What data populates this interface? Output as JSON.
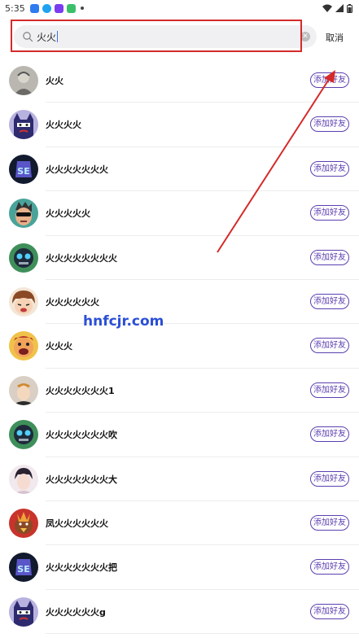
{
  "status_bar": {
    "time": "5:35",
    "app_icons": [
      {
        "name": "app-icon-1",
        "color": "#2f7bf0"
      },
      {
        "name": "app-icon-2",
        "color": "#1fa3f0"
      },
      {
        "name": "app-icon-3",
        "color": "#7a3df0"
      },
      {
        "name": "app-icon-4",
        "color": "#3bbf6a"
      }
    ],
    "icons": [
      "wifi-icon",
      "signal-icon",
      "battery-icon"
    ]
  },
  "search": {
    "query": "火火",
    "cancel_label": "取消"
  },
  "add_label": "添加好友",
  "results": [
    {
      "name": "火火",
      "avatar": "avatar-sketch-portrait"
    },
    {
      "name": "火火火火",
      "avatar": "avatar-cartoon-mask"
    },
    {
      "name": "火火火火火火火",
      "avatar": "avatar-logo-purple"
    },
    {
      "name": "火火火火火",
      "avatar": "avatar-cartoon-cool"
    },
    {
      "name": "火火火火火火火火",
      "avatar": "avatar-cartoon-green"
    },
    {
      "name": "火火火火火火",
      "avatar": "avatar-cartoon-girl"
    },
    {
      "name": "火火火",
      "avatar": "avatar-cartoon-laugh"
    },
    {
      "name": "火火火火火火火1",
      "avatar": "avatar-anime-boy"
    },
    {
      "name": "火火火火火火火吹",
      "avatar": "avatar-cartoon-green"
    },
    {
      "name": "火火火火火火火大",
      "avatar": "avatar-anime-portrait"
    },
    {
      "name": "凤火火火火火火",
      "avatar": "avatar-cartoon-bird"
    },
    {
      "name": "火火火火火火火把",
      "avatar": "avatar-logo-purple"
    },
    {
      "name": "火火火火火火g",
      "avatar": "avatar-cartoon-mask"
    }
  ],
  "watermark": "hnfcjr.com",
  "colors": {
    "accent": "#5b3fb0",
    "highlight": "#d42a2a"
  }
}
